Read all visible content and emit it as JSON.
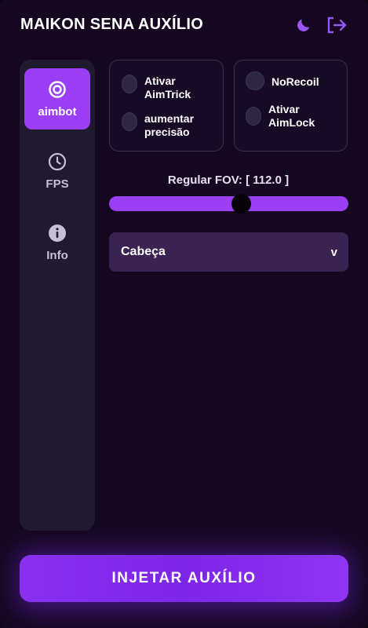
{
  "header": {
    "title": "MAIKON SENA AUXÍLIO",
    "icons": [
      "moon-icon",
      "logout-icon"
    ]
  },
  "sidebar": {
    "items": [
      {
        "label": "aimbot",
        "icon": "target-icon",
        "active": true
      },
      {
        "label": "FPS",
        "icon": "clock-icon",
        "active": false
      },
      {
        "label": "Info",
        "icon": "info-icon",
        "active": false
      }
    ]
  },
  "options": {
    "left": [
      {
        "label": "Ativar AimTrick",
        "enabled": false
      },
      {
        "label": "aumentar precisão",
        "enabled": false
      }
    ],
    "right": [
      {
        "label": "NoRecoil",
        "enabled": false
      },
      {
        "label": "Ativar AimLock",
        "enabled": false
      }
    ]
  },
  "fov": {
    "label": "Regular FOV: [ 112.0 ]",
    "value": 112.0,
    "fraction": 0.552
  },
  "select": {
    "value": "Cabeça",
    "arrow": "v"
  },
  "inject": {
    "label": "INJETAR AUXÍLIO"
  },
  "colors": {
    "background": "#150720",
    "accent": "#9a3ff5",
    "sidebar": "#1f1a2e",
    "select": "#3a2252"
  }
}
